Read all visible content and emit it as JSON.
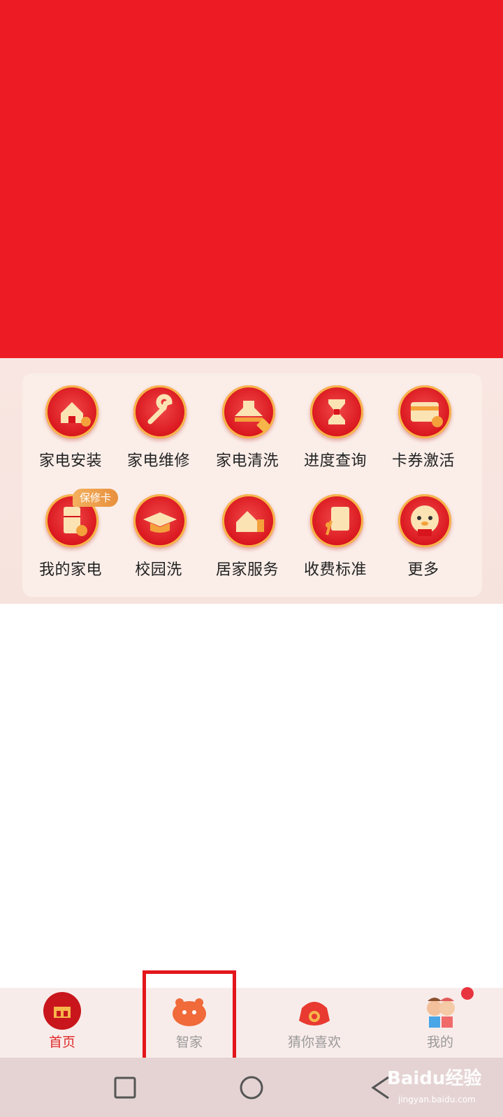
{
  "services": {
    "row1": [
      "家电安装",
      "家电维修",
      "家电清洗",
      "进度查询",
      "卡券激活"
    ],
    "row2": [
      "我的家电",
      "校园洗",
      "居家服务",
      "收费标准",
      "更多"
    ],
    "badge": "保修卡"
  },
  "tabbar": {
    "tabs": [
      {
        "label": "首页",
        "icon": "home-icon",
        "active": true
      },
      {
        "label": "智家",
        "icon": "tiger-icon",
        "active": false
      },
      {
        "label": "猜你喜欢",
        "icon": "lucky-bag-icon",
        "active": false
      },
      {
        "label": "我的",
        "icon": "avatar-icon",
        "active": false
      }
    ]
  },
  "system_nav": [
    "recent-apps-icon",
    "home-circle-icon",
    "back-icon"
  ],
  "watermark": {
    "text": "Baidu经验",
    "sub": "jingyan.baidu.com"
  },
  "colors": {
    "banner": "#ed1c24",
    "accent": "#e02a2a",
    "gold": "#f7b64a"
  }
}
